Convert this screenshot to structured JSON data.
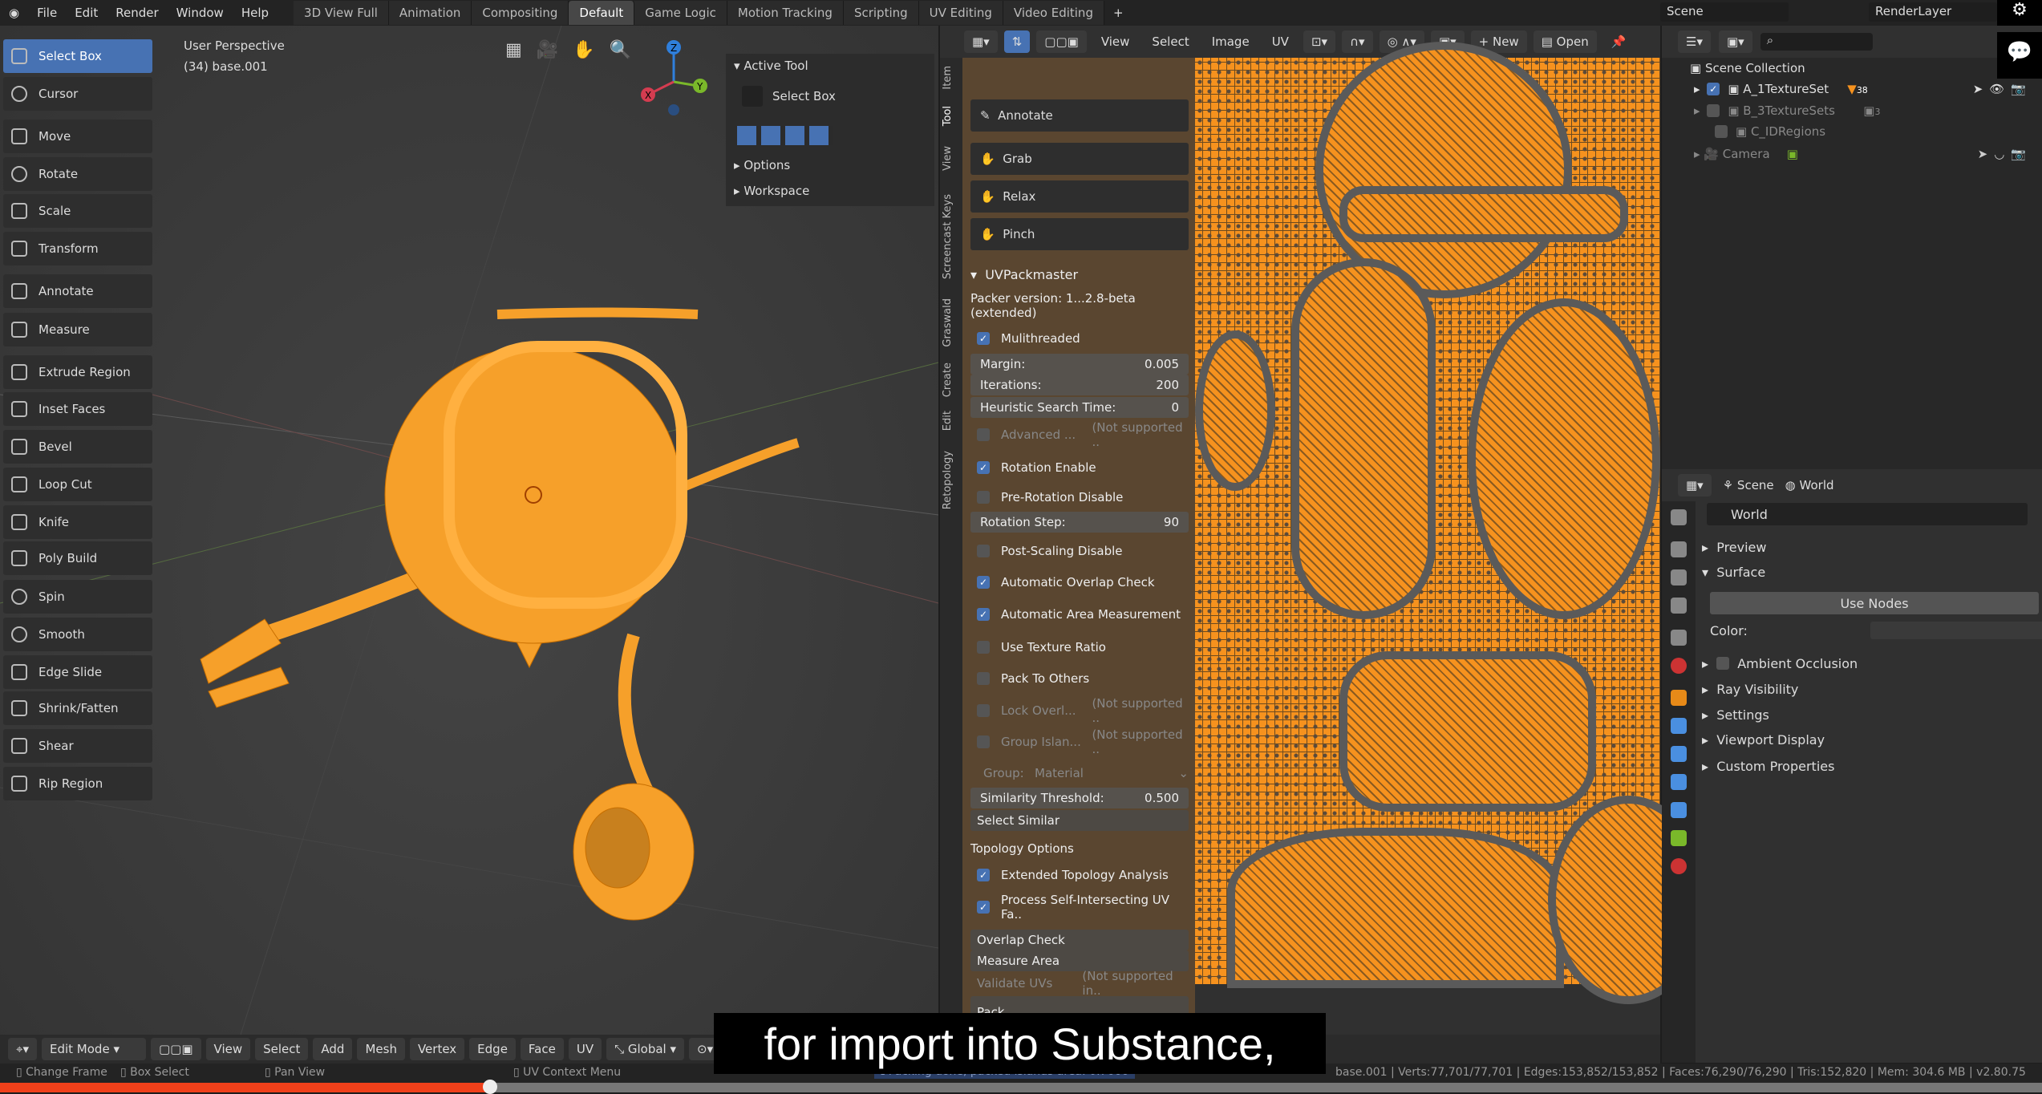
{
  "topbar": {
    "menus": [
      "File",
      "Edit",
      "Render",
      "Window",
      "Help"
    ],
    "workspaces": [
      "3D View Full",
      "Animation",
      "Compositing",
      "Default",
      "Game Logic",
      "Motion Tracking",
      "Scripting",
      "UV Editing",
      "Video Editing"
    ],
    "active_workspace": "Default",
    "add": "+",
    "scene": "Scene",
    "render_layer": "RenderLayer"
  },
  "viewport": {
    "perspective": "User Perspective",
    "object": "(34) base.001",
    "tools": [
      "Select Box",
      "Cursor",
      "Move",
      "Rotate",
      "Scale",
      "Transform",
      "Annotate",
      "Measure",
      "Extrude Region",
      "Inset Faces",
      "Bevel",
      "Loop Cut",
      "Knife",
      "Poly Build",
      "Spin",
      "Smooth",
      "Edge Slide",
      "Shrink/Fatten",
      "Shear",
      "Rip Region"
    ],
    "gizmo": {
      "x": "X",
      "y": "Y",
      "z": "Z"
    },
    "npanel": {
      "active_tool": "Active Tool",
      "tool": "Select Box",
      "options": "Options",
      "workspace": "Workspace",
      "tabs": [
        "Item",
        "Tool",
        "View",
        "Screencast Keys",
        "Graswald",
        "Create",
        "Edit",
        "Retopology"
      ]
    },
    "header": {
      "mode": "Edit Mode",
      "menus": [
        "View",
        "Select",
        "Add",
        "Mesh",
        "Vertex",
        "Edge",
        "Face",
        "UV"
      ],
      "orientation": "Global"
    }
  },
  "uv_editor": {
    "header": {
      "menus": [
        "View",
        "Select",
        "Image",
        "UV"
      ],
      "new": "New",
      "open": "Open"
    },
    "tabs": [
      "Item",
      "Tool",
      "View",
      "Screencast Keys",
      "Graswald",
      "Create",
      "Edit",
      "Retopology"
    ],
    "sculpt_tools": [
      "Annotate",
      "Grab",
      "Relax",
      "Pinch"
    ],
    "uvpackmaster": {
      "title": "UVPackmaster",
      "version": "Packer version: 1...2.8-beta (extended)",
      "multithreaded": "Mulithreaded",
      "margin_label": "Margin:",
      "margin": "0.005",
      "iterations_label": "Iterations:",
      "iterations": "200",
      "heuristic_label": "Heuristic Search Time:",
      "heuristic": "0",
      "advanced": "Advanced ...",
      "not_supported": "(Not supported ..",
      "rotation_enable": "Rotation Enable",
      "pre_rotation": "Pre-Rotation Disable",
      "rotation_step_label": "Rotation Step:",
      "rotation_step": "90",
      "post_scaling": "Post-Scaling Disable",
      "auto_overlap": "Automatic Overlap Check",
      "auto_area": "Automatic Area Measurement",
      "tex_ratio": "Use Texture Ratio",
      "pack_others": "Pack To Others",
      "lock_overlap": "Lock Overl...",
      "group_islands": "Group Islan...",
      "group_label": "Group:",
      "group_value": "Material",
      "similarity_label": "Similarity Threshold:",
      "similarity": "0.500",
      "select_similar": "Select Similar",
      "topology": "Topology Options",
      "extended_topology": "Extended Topology Analysis",
      "process_self": "Process Self-Intersecting UV Fa..",
      "overlap_check": "Overlap Check",
      "measure_area": "Measure Area",
      "validate": "Validate UVs",
      "validate_ns": "(Not supported in..",
      "pack": "Pack"
    }
  },
  "outliner": {
    "root": "Scene Collection",
    "items": [
      {
        "name": "A_1TextureSet",
        "badge": "38",
        "checked": true
      },
      {
        "name": "B_3TextureSets",
        "badge": "3",
        "checked": false
      },
      {
        "name": "C_IDRegions",
        "checked": false
      },
      {
        "name": "Camera"
      }
    ]
  },
  "properties": {
    "scene": "Scene",
    "world_tab": "World",
    "world": "World",
    "preview": "Preview",
    "surface": "Surface",
    "use_nodes": "Use Nodes",
    "color": "Color:",
    "ambient_occlusion": "Ambient Occlusion",
    "ray_visibility": "Ray Visibility",
    "settings": "Settings",
    "viewport_display": "Viewport Display",
    "custom_properties": "Custom Properties"
  },
  "status": {
    "change_frame": "Change Frame",
    "box_select": "Box Select",
    "pan_view": "Pan View",
    "uv_context": "UV Context Menu",
    "message": "Packing done, packed islands area: 0.7666",
    "stats": "base.001 | Verts:77,701/77,701 | Edges:153,852/153,852 | Faces:76,290/76,290 | Tris:152,820 | Mem: 304.6 MB | v2.80.75"
  },
  "video": {
    "subtitle": "for import into Substance,",
    "progress_percent": 24
  },
  "colors": {
    "accent": "#4772b3",
    "uv_orange": "#f6921e",
    "progress": "#f0401a"
  }
}
